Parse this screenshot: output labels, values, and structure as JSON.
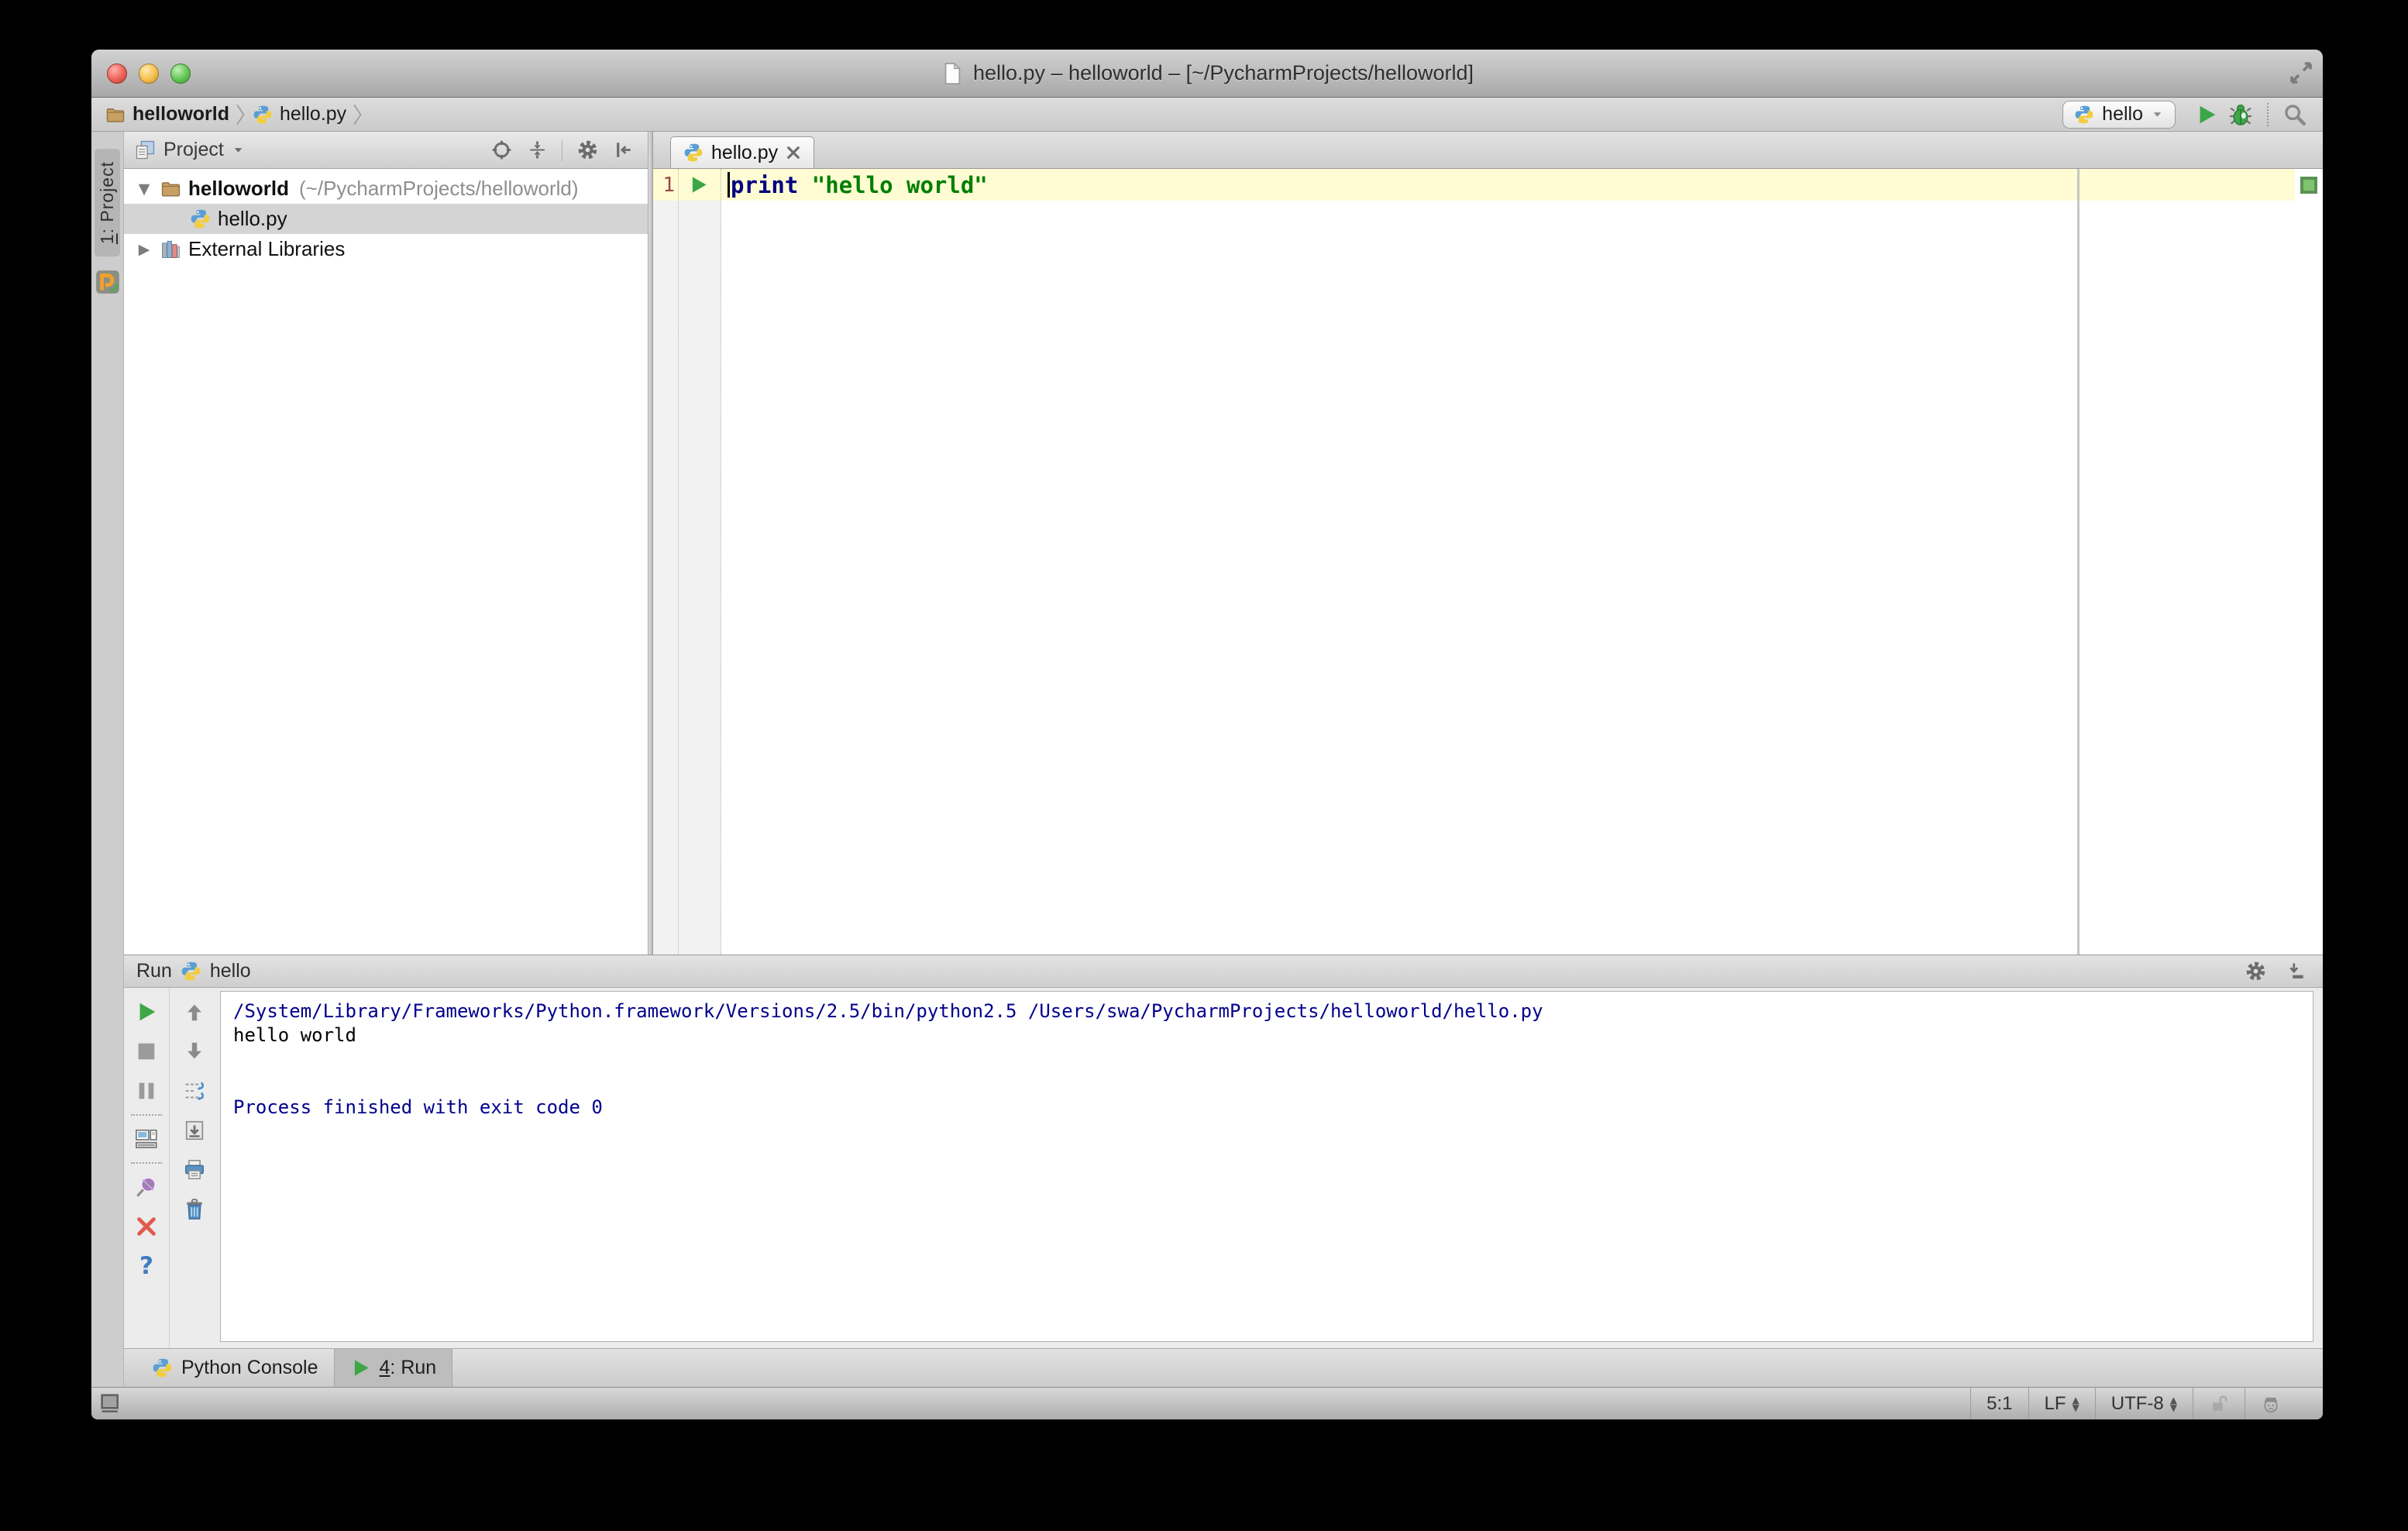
{
  "window": {
    "title": "hello.py – helloworld – [~/PycharmProjects/helloworld]"
  },
  "toolbar": {
    "breadcrumb_project": "helloworld",
    "breadcrumb_file": "hello.py",
    "run_config_label": "hello"
  },
  "left_stripe": {
    "project_button_number": "1",
    "project_button_label": ": Project"
  },
  "project_panel": {
    "header_label": "Project",
    "root_name": "helloworld",
    "root_path": "(~/PycharmProjects/helloworld)",
    "file_name": "hello.py",
    "external_libraries_label": "External Libraries"
  },
  "editor": {
    "tab_label": "hello.py",
    "line_number": "1",
    "code": {
      "keyword": "print",
      "string": "\"hello world\""
    }
  },
  "run_panel": {
    "title": "Run",
    "config_name": "hello",
    "console_lines": [
      {
        "text": "/System/Library/Frameworks/Python.framework/Versions/2.5/bin/python2.5 /Users/swa/PycharmProjects/helloworld/hello.py"
      },
      {
        "text": "hello world"
      },
      {
        "text": "Process finished with exit code 0"
      }
    ]
  },
  "bottom_bar": {
    "python_console_label": "Python Console",
    "run_tab_number": "4",
    "run_tab_label": ": Run"
  },
  "status_bar": {
    "caret_position": "5:1",
    "line_separator": "LF",
    "encoding": "UTF-8"
  },
  "colors": {
    "run_green": "#3da647",
    "current_line_highlight": "#fffcd4",
    "keyword": "#000080",
    "string": "#008000",
    "console_info": "#00008b",
    "selection": "#d4d4d4",
    "inspection_ok": "#7cc56e"
  }
}
